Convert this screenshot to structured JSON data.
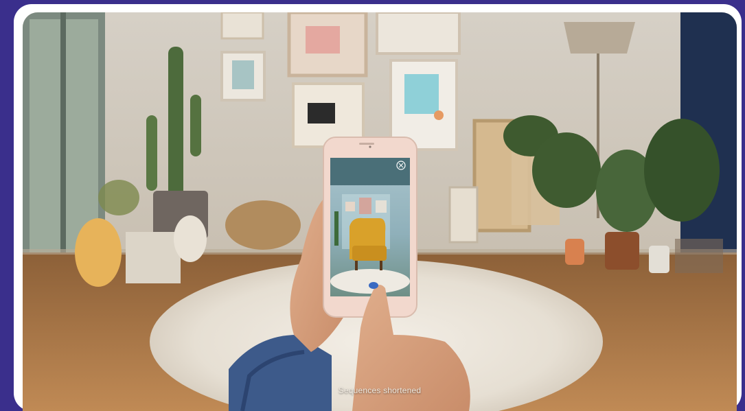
{
  "scene": {
    "caption": "Sequences shortened"
  },
  "colors": {
    "border": "#3a2f8c",
    "frame": "#ffffff",
    "wall": "#d6cfc4",
    "floor": "#b5834f",
    "rug": "#ece6dc",
    "chair": "#d9a12a"
  },
  "icons": {
    "phone_close": "close-icon"
  }
}
